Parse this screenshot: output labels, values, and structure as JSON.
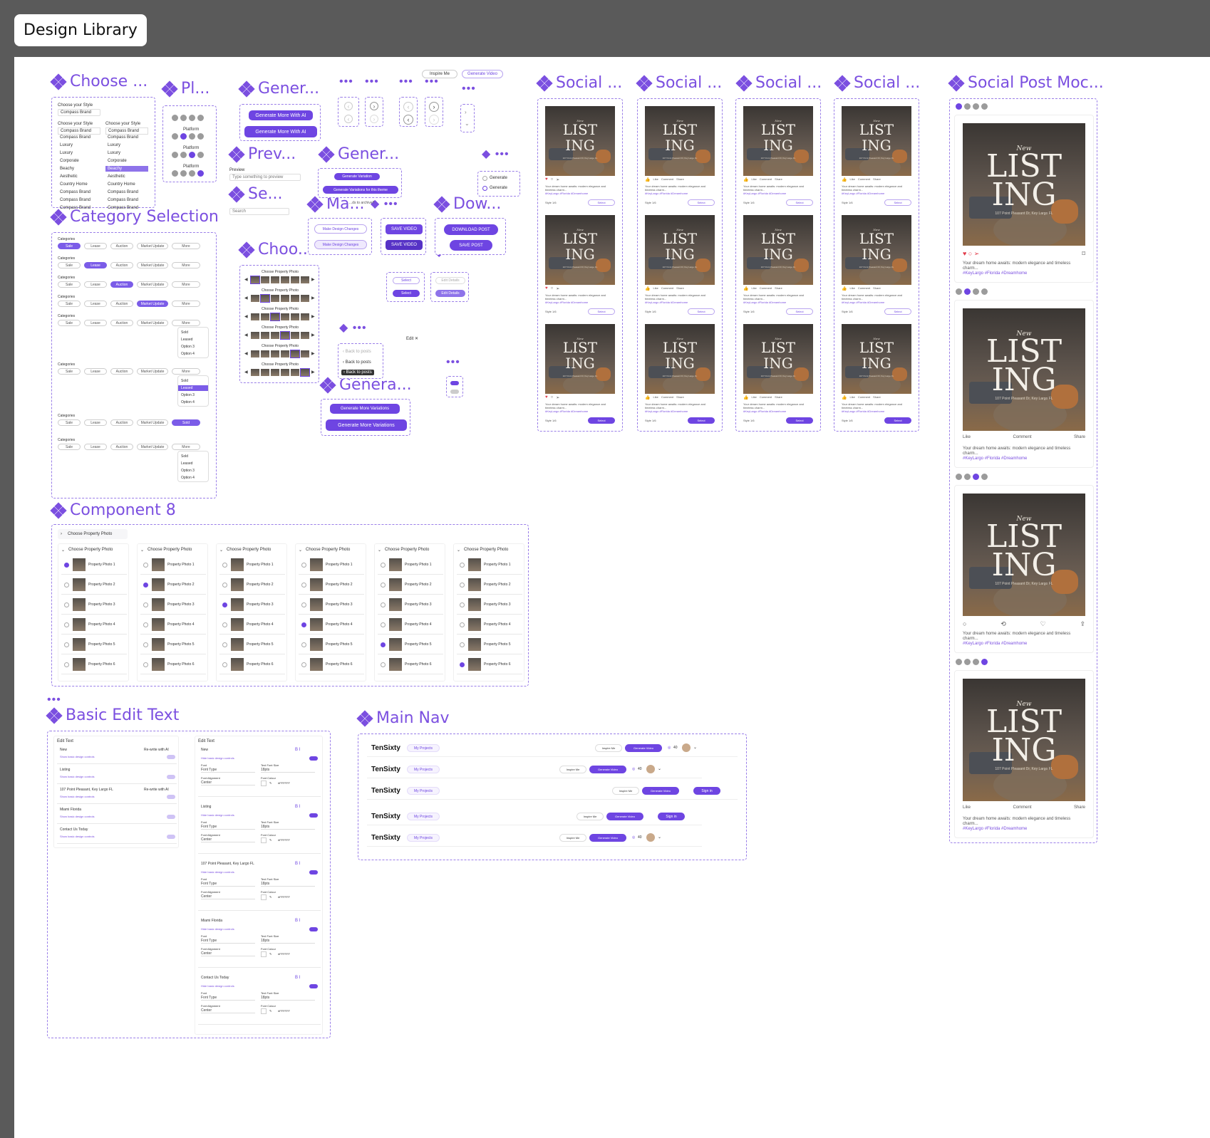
{
  "page": {
    "title": "Design Library"
  },
  "components": {
    "choose_style": "Choose ...",
    "platform": "Pl...",
    "generate1": "Gener...",
    "preview": "Prev...",
    "generate2": "Gener...",
    "search": "Se...",
    "make": "Ma...",
    "download": "Dow...",
    "category_selection": "Category Selection",
    "choose_photo": "Choo...",
    "generate3": "Genera...",
    "social1": "Social ...",
    "social2": "Social ...",
    "social3": "Social ...",
    "social4": "Social ...",
    "social_mock": "Social Post Moc...",
    "component8": "Component 8",
    "basic_edit_text": "Basic Edit Text",
    "main_nav": "Main Nav"
  },
  "chips": {
    "inspire": "Inspire Me",
    "generate_video": "Generate Video"
  },
  "choose_style": {
    "label": "Choose your Style",
    "selected": "Compass Brand",
    "options": [
      "Compass Brand",
      "Luxury",
      "Luxury",
      "Corporate",
      "Beachy",
      "Aesthetic",
      "Country Home",
      "Compass Brand",
      "Compass Brand",
      "Compass Brand"
    ],
    "highlight": "Beachy"
  },
  "platform": {
    "label": "Platform"
  },
  "buttons": {
    "gen_more_ai": "Generate More With AI",
    "gen_variation": "Generate Variation",
    "gen_variations_theme": "Generate Variations for this theme",
    "make_changes": "Make Design Changes",
    "save_video": "SAVE VIDEO",
    "download_post": "DOWNLOAD POST",
    "save_post": "SAVE POST",
    "select": "Select",
    "edit_details": "Edit Details",
    "gen_more_variations": "Generate More Variations",
    "generate": "Generate",
    "back_to_posts": "Back to posts",
    "edit": "Edit"
  },
  "preview": {
    "label": "Preview",
    "placeholder": "Type something to preview"
  },
  "search": {
    "placeholder": "Search"
  },
  "archive_note": "...ds to archive?",
  "categories": {
    "label": "Categories",
    "items": [
      "Sale",
      "Lease",
      "Auction",
      "Market Update",
      "More"
    ],
    "dropdown": [
      "Sold",
      "Leased",
      "Option 3",
      "Option 4"
    ],
    "selected_sold": "Sold"
  },
  "choose_photo": {
    "label": "Choose Property Photo"
  },
  "social": {
    "new": "New",
    "listing_line1": "LIST",
    "listing_line2": "ING",
    "address": "107 Point Pleasant Dr, Key Largo FL",
    "caption": "Your dream home awaits: modern elegance and timeless charm...",
    "hashtags": "#KeyLargo #Florida #Dreamhome",
    "style_label": "Style 1/6",
    "like": "Like",
    "comment": "Comment",
    "share": "Share"
  },
  "photo_list": {
    "header": "Choose Property Photo",
    "items": [
      "Property Photo 1",
      "Property Photo 2",
      "Property Photo 3",
      "Property Photo 4",
      "Property Photo 5",
      "Property Photo 6"
    ]
  },
  "edit_text": {
    "header": "Edit Text",
    "rewrite": "Re-write with AI",
    "show_controls": "Show basic design controls",
    "hide_controls": "Hide basic design controls",
    "fields": [
      "New",
      "Listing",
      "107 Point Pleasant, Key Largo FL",
      "Miami Florida",
      "Contact Us Today"
    ],
    "font": "Font",
    "font_type": "Font Type",
    "text_font_size": "Text Font Size",
    "font_size_value": "18pts",
    "font_alignment": "Font Alignment",
    "alignment_value": "Center",
    "font_colour": "Font Colour",
    "colour_value": "#FFFFFF"
  },
  "nav": {
    "brand": "TenSixty",
    "my_projects": "My Projects",
    "inspire": "Inspire Me",
    "generate_video": "Generate Video",
    "credits": "40",
    "sign_in": "Sign in"
  }
}
